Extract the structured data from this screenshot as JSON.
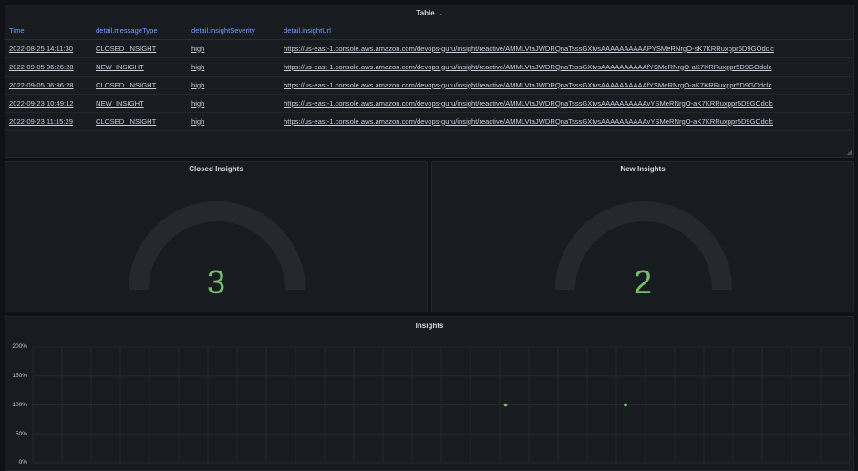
{
  "table_panel": {
    "title": "Table",
    "chevron": "⌄",
    "columns": [
      "Time",
      "detail.messageType",
      "detail.insightSeverity",
      "detail.insightUrl"
    ],
    "rows": [
      [
        "2022-08-25 14:11:30",
        "CLOSED_INSIGHT",
        "high",
        "https://us-east-1.console.aws.amazon.com/devops-guru/insight/reactive/AMMLVtaJWDRQnaTsssGXtvsAAAAAAAAAAPYSMeRNrgO-sK7KRRuxppr5D9GOdclc"
      ],
      [
        "2022-09-05 06:26:28",
        "NEW_INSIGHT",
        "high",
        "https://us-east-1.console.aws.amazon.com/devops-guru/insight/reactive/AMMLVtaJWDRQnaTsssGXtvsAAAAAAAAAAfYSMeRNrgO-aK7KRRuxppr5D9GOdclc"
      ],
      [
        "2022-09-05 06:36:28",
        "CLOSED_INSIGHT",
        "high",
        "https://us-east-1.console.aws.amazon.com/devops-guru/insight/reactive/AMMLVtaJWDRQnaTsssGXtvsAAAAAAAAAAfYSMeRNrgO-aK7KRRuxppr5D9GOdclc"
      ],
      [
        "2022-09-23 10:49:12",
        "NEW_INSIGHT",
        "high",
        "https://us-east-1.console.aws.amazon.com/devops-guru/insight/reactive/AMMLVtaJWDRQnaTsssGXtvsAAAAAAAAAAvYSMeRNrgO-aK7KRRuxppr5D9GOdclc"
      ],
      [
        "2022-09-23 11:15:29",
        "CLOSED_INSIGHT",
        "high",
        "https://us-east-1.console.aws.amazon.com/devops-guru/insight/reactive/AMMLVtaJWDRQnaTsssGXtvsAAAAAAAAAAvYSMeRNrgO-aK7KRRuxppr5D9GOdclc"
      ]
    ]
  },
  "closed_gauge": {
    "title": "Closed Insights",
    "value": "3",
    "value_color": "#73bf69"
  },
  "new_gauge": {
    "title": "New Insights",
    "value": "2",
    "value_color": "#73bf69"
  },
  "insights_panel": {
    "title": "Insights",
    "y_ticks": [
      "200%",
      "150%",
      "100%",
      "50%",
      "0%"
    ]
  },
  "chart_data": {
    "type": "scatter",
    "title": "Insights",
    "ylim": [
      0,
      200
    ],
    "y_unit": "%",
    "grid": true,
    "point_color": "#73bf69",
    "points": [
      {
        "x": "2022-09-05 06:26",
        "y": 100
      },
      {
        "x": "2022-09-05 06:36",
        "y": 100
      },
      {
        "x": "2022-09-23 10:49",
        "y": 100
      },
      {
        "x": "2022-09-23 11:15",
        "y": 100
      }
    ]
  },
  "colors": {
    "background": "#111217",
    "panel": "#181b1f",
    "header_text": "#6e9fff",
    "accent_green": "#73bf69"
  }
}
